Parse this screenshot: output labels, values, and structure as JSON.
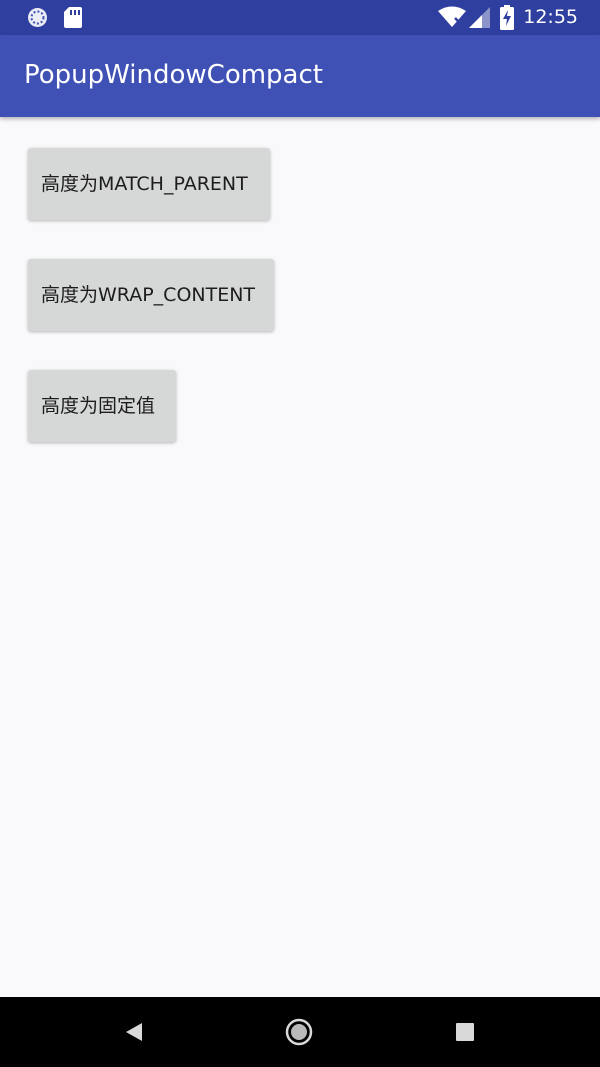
{
  "status_bar": {
    "time": "12:55",
    "icons": [
      "sync-spinner-icon",
      "sd-card-icon",
      "wifi-icon",
      "signal-icon",
      "battery-charging-icon"
    ]
  },
  "app_bar": {
    "title": "PopupWindowCompact"
  },
  "buttons": [
    {
      "label": "高度为MATCH_PARENT"
    },
    {
      "label": "高度为WRAP_CONTENT"
    },
    {
      "label": "高度为固定值"
    }
  ],
  "nav_bar": {
    "icons": [
      "back-icon",
      "home-icon",
      "recents-icon"
    ]
  },
  "colors": {
    "status_bar": "#2f3f9f",
    "app_bar": "#3f51b5",
    "background": "#f9f8fa",
    "button": "#d6d7d7",
    "nav_bar": "#000000"
  }
}
